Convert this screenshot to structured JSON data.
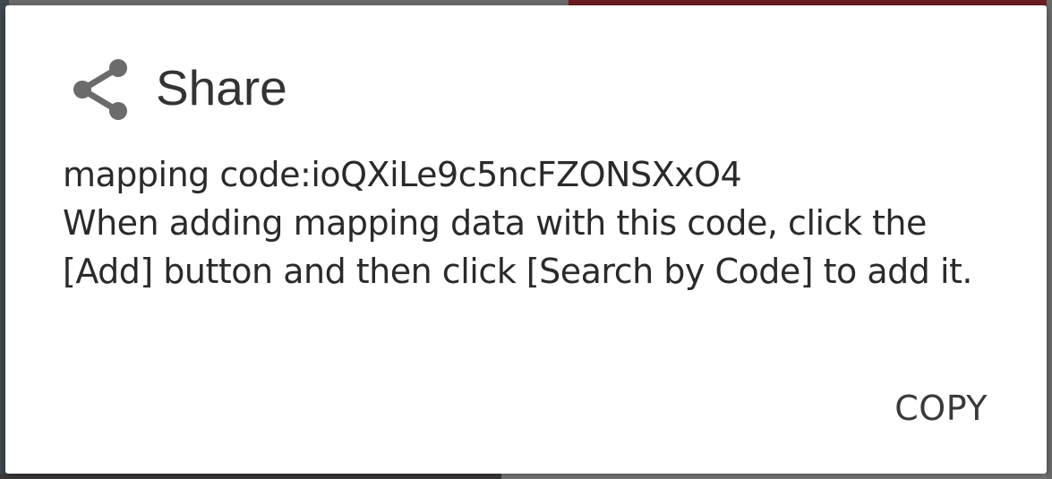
{
  "dialog": {
    "icon": "share-icon",
    "title": "Share",
    "code_line": "mapping code:ioQXiLe9c5ncFZONSXxO4",
    "message": "When adding mapping data with this code, click the [Add] button and then click [Search by Code] to add it.",
    "copy_label": "COPY"
  },
  "colors": {
    "icon": "#6b6b6b",
    "title": "#333333",
    "body_text": "#2a2a2a",
    "button_text": "#3a3a3a",
    "dialog_bg": "#ffffff",
    "scrim": "#5f5f5f"
  }
}
